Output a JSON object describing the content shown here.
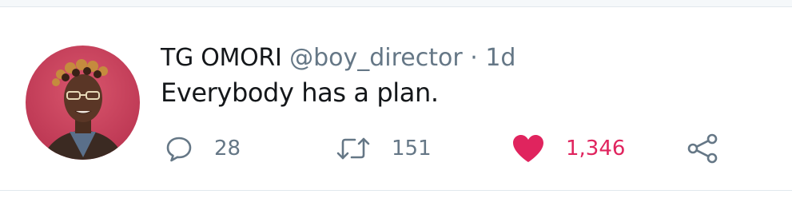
{
  "tweet": {
    "display_name": "TG OMORI",
    "handle": "@boy_director",
    "separator": "·",
    "time": "1d",
    "text": "Everybody has a plan."
  },
  "actions": {
    "reply": {
      "icon": "reply-bubble-icon",
      "count": "28"
    },
    "retweet": {
      "icon": "retweet-icon",
      "count": "151"
    },
    "like": {
      "icon": "heart-icon",
      "count": "1,346",
      "liked": true,
      "color": "#e0245e"
    },
    "share": {
      "icon": "share-icon"
    }
  },
  "colors": {
    "text_primary": "#14171a",
    "text_secondary": "#657786",
    "like": "#e0245e",
    "divider": "#e1e8ed",
    "avatar_background": "#c8405b"
  }
}
